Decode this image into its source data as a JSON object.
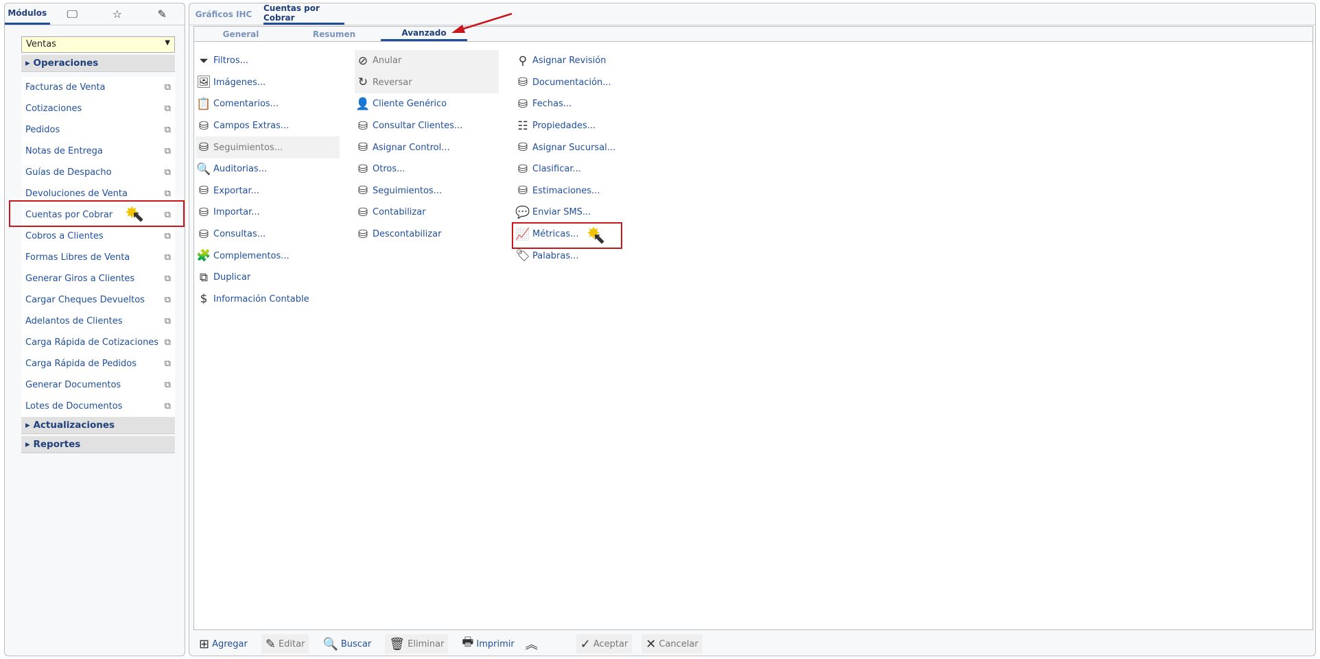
{
  "left_panel": {
    "tabs": [
      {
        "label": "Módulos"
      },
      {
        "icon": "monitor-icon",
        "glyph": "🖵"
      },
      {
        "icon": "star-icon",
        "glyph": "☆"
      },
      {
        "icon": "edit-doc-icon",
        "glyph": "✎"
      }
    ],
    "module_select": {
      "value": "Ventas",
      "arrow": "▼"
    },
    "groups": {
      "operaciones": "Operaciones",
      "actualizaciones": "Actualizaciones",
      "reportes": "Reportes"
    },
    "items": [
      "Facturas de Venta",
      "Cotizaciones",
      "Pedidos",
      "Notas de Entrega",
      "Guías de Despacho",
      "Devoluciones de Venta",
      "Cuentas por Cobrar",
      "Cobros a Clientes",
      "Formas Libres de Venta",
      "Generar Giros a Clientes",
      "Cargar Cheques Devueltos",
      "Adelantos de Clientes",
      "Carga Rápida de Cotizaciones",
      "Carga Rápida de Pedidos",
      "Generar Documentos",
      "Lotes de Documentos"
    ],
    "highlighted_item": "Cuentas por Cobrar"
  },
  "main": {
    "tabs": [
      "Gráficos IHC",
      "Cuentas por Cobrar"
    ],
    "active_tab": "Cuentas por Cobrar",
    "subtabs": [
      "General",
      "Resumen",
      "Avanzado"
    ],
    "active_subtab": "Avanzado",
    "columns": [
      [
        {
          "label": "Filtros...",
          "icon": "⏷"
        },
        {
          "label": "Imágenes...",
          "icon": "🖼"
        },
        {
          "label": "Comentarios...",
          "icon": "📋"
        },
        {
          "label": "Campos Extras...",
          "icon": "⛁"
        },
        {
          "label": "Seguimientos...",
          "icon": "⛁",
          "disabled": true
        },
        {
          "label": "Auditorias...",
          "icon": "🔍"
        },
        {
          "label": "Exportar...",
          "icon": "⛁"
        },
        {
          "label": "Importar...",
          "icon": "⛁"
        },
        {
          "label": "Consultas...",
          "icon": "⛁"
        },
        {
          "label": "Complementos...",
          "icon": "🧩"
        },
        {
          "label": "Duplicar",
          "icon": "⧉"
        },
        {
          "label": "Información Contable",
          "icon": "$"
        }
      ],
      [
        {
          "label": "Anular",
          "icon": "⊘",
          "disabled": true
        },
        {
          "label": "Reversar",
          "icon": "↻",
          "disabled": true
        },
        {
          "label": "Cliente Genérico",
          "icon": "👤"
        },
        {
          "label": "Consultar Clientes...",
          "icon": "⛁"
        },
        {
          "label": "Asignar Control...",
          "icon": "⛁"
        },
        {
          "label": "Otros...",
          "icon": "⛁"
        },
        {
          "label": "Seguimientos...",
          "icon": "⛁"
        },
        {
          "label": "Contabilizar",
          "icon": "⛁"
        },
        {
          "label": "Descontabilizar",
          "icon": "⛁"
        }
      ],
      [
        {
          "label": "Asignar Revisión",
          "icon": "⚲"
        },
        {
          "label": "Documentación...",
          "icon": "⛁"
        },
        {
          "label": "Fechas...",
          "icon": "⛁"
        },
        {
          "label": "Propiedades...",
          "icon": "☷"
        },
        {
          "label": "Asignar Sucursal...",
          "icon": "⛁"
        },
        {
          "label": "Clasificar...",
          "icon": "⛁"
        },
        {
          "label": "Estimaciones...",
          "icon": "⛁"
        },
        {
          "label": "Enviar SMS...",
          "icon": "💬"
        },
        {
          "label": "Métricas...",
          "icon": "📈"
        },
        {
          "label": "Palabras...",
          "icon": "🏷"
        }
      ]
    ],
    "toolbar": {
      "agregar": "Agregar",
      "editar": "Editar",
      "buscar": "Buscar",
      "eliminar": "Eliminar",
      "imprimir": "Imprimir",
      "aceptar": "Aceptar",
      "cancelar": "Cancelar"
    }
  },
  "annotation_color": "#c8161d"
}
